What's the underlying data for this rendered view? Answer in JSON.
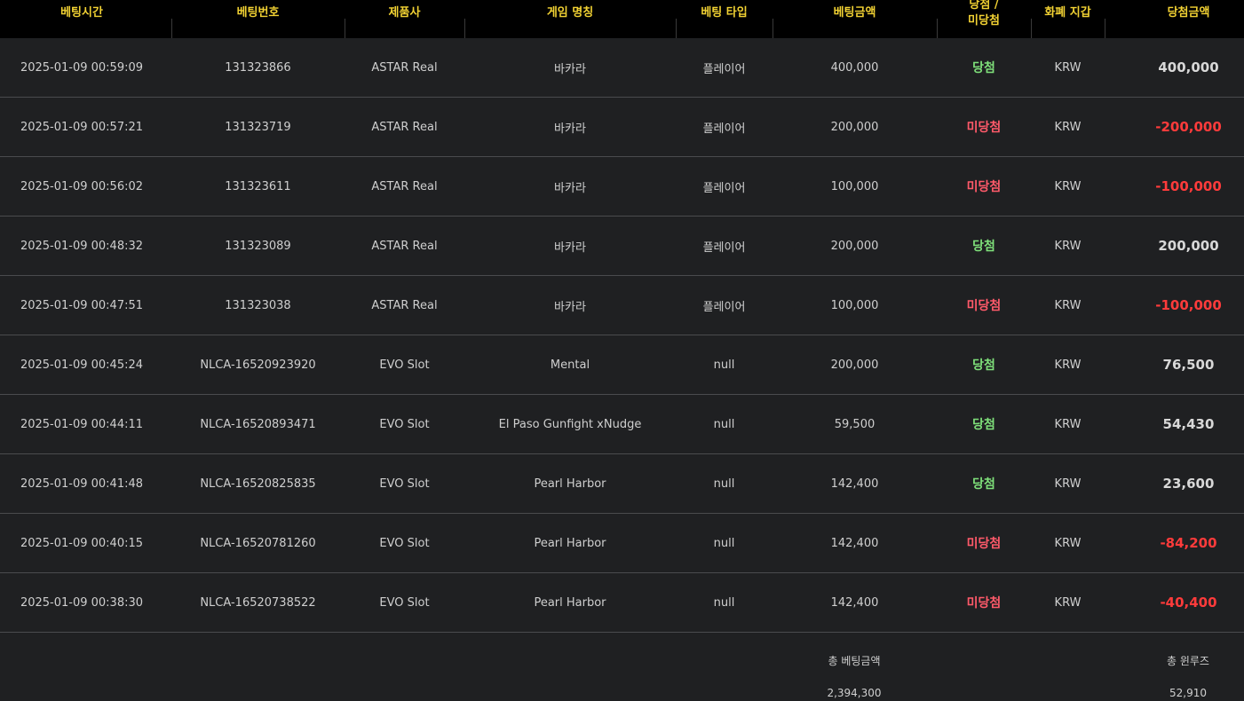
{
  "table": {
    "headers": [
      "베팅시간",
      "베팅번호",
      "제품사",
      "게임 명칭",
      "베팅 타입",
      "베팅금액",
      "당첨 /\n미당첨",
      "화폐 지갑",
      "당첨금액"
    ],
    "rows": [
      {
        "time": "2025-01-09 00:59:09",
        "bet_id": "131323866",
        "provider": "ASTAR Real",
        "game": "바카라",
        "type": "플레이어",
        "amount": "400,000",
        "result": "당첨",
        "currency": "KRW",
        "win_amount": "400,000"
      },
      {
        "time": "2025-01-09 00:57:21",
        "bet_id": "131323719",
        "provider": "ASTAR Real",
        "game": "바카라",
        "type": "플레이어",
        "amount": "200,000",
        "result": "미당첨",
        "currency": "KRW",
        "win_amount": "-200,000"
      },
      {
        "time": "2025-01-09 00:56:02",
        "bet_id": "131323611",
        "provider": "ASTAR Real",
        "game": "바카라",
        "type": "플레이어",
        "amount": "100,000",
        "result": "미당첨",
        "currency": "KRW",
        "win_amount": "-100,000"
      },
      {
        "time": "2025-01-09 00:48:32",
        "bet_id": "131323089",
        "provider": "ASTAR Real",
        "game": "바카라",
        "type": "플레이어",
        "amount": "200,000",
        "result": "당첨",
        "currency": "KRW",
        "win_amount": "200,000"
      },
      {
        "time": "2025-01-09 00:47:51",
        "bet_id": "131323038",
        "provider": "ASTAR Real",
        "game": "바카라",
        "type": "플레이어",
        "amount": "100,000",
        "result": "미당첨",
        "currency": "KRW",
        "win_amount": "-100,000"
      },
      {
        "time": "2025-01-09 00:45:24",
        "bet_id": "NLCA-16520923920",
        "provider": "EVO Slot",
        "game": "Mental",
        "type": "null",
        "amount": "200,000",
        "result": "당첨",
        "currency": "KRW",
        "win_amount": "76,500"
      },
      {
        "time": "2025-01-09 00:44:11",
        "bet_id": "NLCA-16520893471",
        "provider": "EVO Slot",
        "game": "El Paso Gunfight xNudge",
        "type": "null",
        "amount": "59,500",
        "result": "당첨",
        "currency": "KRW",
        "win_amount": "54,430"
      },
      {
        "time": "2025-01-09 00:41:48",
        "bet_id": "NLCA-16520825835",
        "provider": "EVO Slot",
        "game": "Pearl Harbor",
        "type": "null",
        "amount": "142,400",
        "result": "당첨",
        "currency": "KRW",
        "win_amount": "23,600"
      },
      {
        "time": "2025-01-09 00:40:15",
        "bet_id": "NLCA-16520781260",
        "provider": "EVO Slot",
        "game": "Pearl Harbor",
        "type": "null",
        "amount": "142,400",
        "result": "미당첨",
        "currency": "KRW",
        "win_amount": "-84,200"
      },
      {
        "time": "2025-01-09 00:38:30",
        "bet_id": "NLCA-16520738522",
        "provider": "EVO Slot",
        "game": "Pearl Harbor",
        "type": "null",
        "amount": "142,400",
        "result": "미당첨",
        "currency": "KRW",
        "win_amount": "-40,400"
      }
    ]
  },
  "summary": {
    "total_bet_label": "총 베팅금액",
    "total_bet_value": "2,394,300",
    "total_winloss_label": "총 윈루즈",
    "total_winloss_value": "52,910"
  },
  "colors": {
    "header_bg": "#000000",
    "header_text": "#f2d233",
    "row_bg": "#1f2022",
    "win": "#7fe07a",
    "lose": "#ff5a6a",
    "negative_amount": "#ff3b3b"
  }
}
